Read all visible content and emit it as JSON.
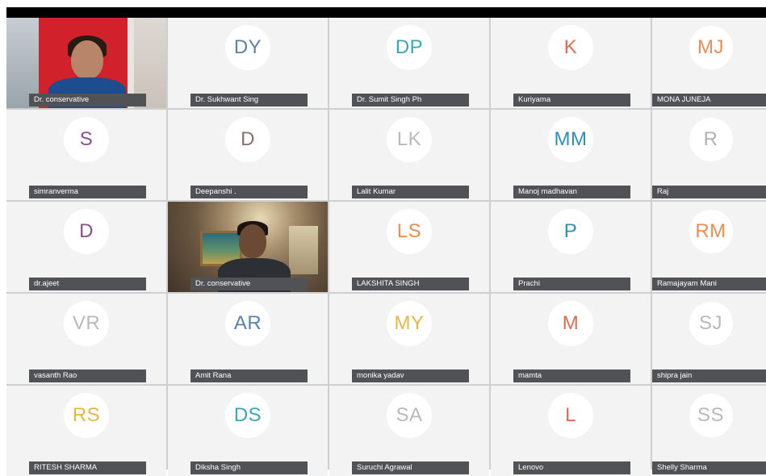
{
  "participants": [
    {
      "initials": "",
      "name": "Dr. conservative",
      "color": "#000000"
    },
    {
      "initials": "DY",
      "name": "Dr. Sukhwant Sing",
      "color": "#5a7fb3"
    },
    {
      "initials": "DP",
      "name": "Dr. Sumit Singh Ph",
      "color": "#3aa6b8"
    },
    {
      "initials": "K",
      "name": "Kuriyama",
      "color": "#e46a4f"
    },
    {
      "initials": "MJ",
      "name": "MONA JUNEJA",
      "color": "#e88e52"
    },
    {
      "initials": "S",
      "name": "simranverma",
      "color": "#8a4f8f"
    },
    {
      "initials": "D",
      "name": "Deepanshi .",
      "color": "#8b6e6e"
    },
    {
      "initials": "LK",
      "name": "Lalit Kumar",
      "color": "#b9b9b9"
    },
    {
      "initials": "MM",
      "name": "Manoj madhavan",
      "color": "#2b8fc4"
    },
    {
      "initials": "R",
      "name": "Raj",
      "color": "#b1b1b1"
    },
    {
      "initials": "D",
      "name": "dr.ajeet",
      "color": "#8a4f8f"
    },
    {
      "initials": "",
      "name": "Dr. conservative",
      "color": "#000000"
    },
    {
      "initials": "LS",
      "name": "LAKSHITA SINGH",
      "color": "#e88e52"
    },
    {
      "initials": "P",
      "name": "Prachi",
      "color": "#2b8fc4"
    },
    {
      "initials": "RM",
      "name": "Ramajayam Mani",
      "color": "#e88e52"
    },
    {
      "initials": "VR",
      "name": "vasanth Rao",
      "color": "#b9b9b9"
    },
    {
      "initials": "AR",
      "name": "Amit Rana",
      "color": "#5a7fb3"
    },
    {
      "initials": "MY",
      "name": "monika yadav",
      "color": "#e8b83c"
    },
    {
      "initials": "M",
      "name": "mamta",
      "color": "#e46a4f"
    },
    {
      "initials": "SJ",
      "name": "shipra jain",
      "color": "#b9b9b9"
    },
    {
      "initials": "RS",
      "name": "RITESH SHARMA",
      "color": "#e8b83c"
    },
    {
      "initials": "DS",
      "name": "Diksha Singh",
      "color": "#3aa6b8"
    },
    {
      "initials": "SA",
      "name": "Suruchi Agrawal",
      "color": "#b9b9b9"
    },
    {
      "initials": "L",
      "name": "Lenovo",
      "color": "#e46a4f"
    },
    {
      "initials": "SS",
      "name": "Shelly Sharma",
      "color": "#b9b9b9"
    }
  ]
}
